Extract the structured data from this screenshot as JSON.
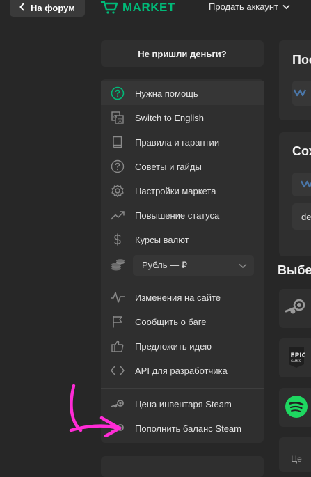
{
  "topbar": {
    "back_label": "На форум",
    "logo_text": "MARKET",
    "sell_label": "Продать аккаунт"
  },
  "sidebar": {
    "header": "Не пришли деньги?",
    "items": [
      {
        "label": "Нужна помощь",
        "icon": "question-circle-icon"
      },
      {
        "label": "Switch to English",
        "icon": "translate-icon"
      },
      {
        "label": "Правила и гарантии",
        "icon": "book-icon"
      },
      {
        "label": "Советы и гайды",
        "icon": "question-circle-icon"
      },
      {
        "label": "Настройки маркета",
        "icon": "gear-icon"
      },
      {
        "label": "Повышение статуса",
        "icon": "trend-up-icon"
      },
      {
        "label": "Курсы валют",
        "icon": "dollar-icon"
      }
    ],
    "currency": {
      "value": "Рубль — ₽",
      "icon": "coins-icon"
    },
    "items2": [
      {
        "label": "Изменения на сайте",
        "icon": "pulse-icon"
      },
      {
        "label": "Сообщить о баге",
        "icon": "flag-icon"
      },
      {
        "label": "Предложить идею",
        "icon": "thumbs-up-icon"
      },
      {
        "label": "API для разработчика",
        "icon": "code-icon"
      }
    ],
    "items3": [
      {
        "label": "Цена инвентаря Steam",
        "icon": "steam-icon"
      },
      {
        "label": "Пополнить баланс Steam",
        "icon": "steam-icon"
      }
    ]
  },
  "right": {
    "card1_title": "Пос",
    "card2_title": "Сох",
    "card2_field": "de",
    "section_title": "Выбе",
    "bottom_text": "Це"
  },
  "colors": {
    "accent": "#00ba78",
    "background": "#272727",
    "panel": "#2f2f2f",
    "annotation": "#ff2bd6"
  }
}
